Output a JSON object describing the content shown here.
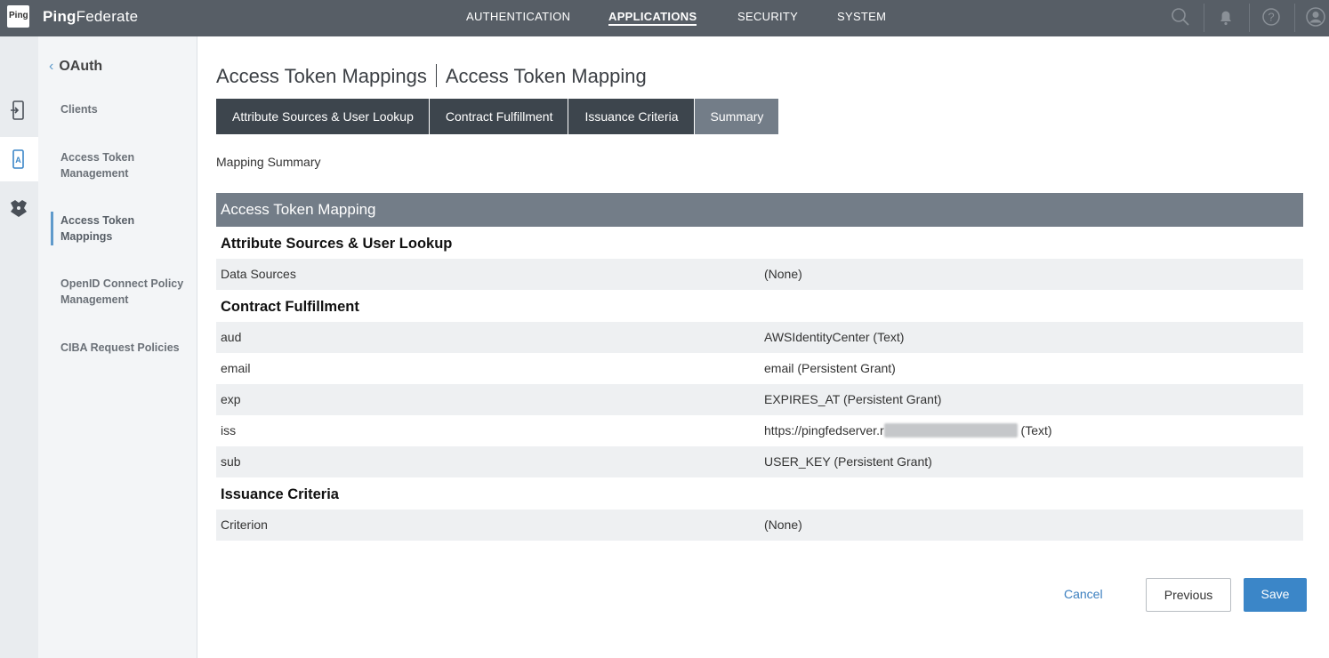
{
  "brand": {
    "logo_text": "Ping",
    "name_bold": "Ping",
    "name_rest": "Federate"
  },
  "topnav": {
    "items": [
      {
        "label": "AUTHENTICATION",
        "active": false
      },
      {
        "label": "APPLICATIONS",
        "active": true
      },
      {
        "label": "SECURITY",
        "active": false
      },
      {
        "label": "SYSTEM",
        "active": false
      }
    ],
    "icons": [
      "search-icon",
      "bell-icon",
      "help-icon",
      "user-icon"
    ]
  },
  "rail": {
    "icons": [
      "device-icon",
      "app-icon",
      "shield-icon"
    ]
  },
  "sidebar": {
    "back_label": "OAuth",
    "items": [
      {
        "label": "Clients",
        "active": false
      },
      {
        "label": "Access Token Management",
        "active": false
      },
      {
        "label": "Access Token Mappings",
        "active": true
      },
      {
        "label": "OpenID Connect Policy Management",
        "active": false
      },
      {
        "label": "CIBA Request Policies",
        "active": false
      }
    ]
  },
  "page": {
    "breadcrumb_parent": "Access Token Mappings",
    "title": "Access Token Mapping",
    "tabs": [
      {
        "label": "Attribute Sources & User Lookup",
        "selected": false
      },
      {
        "label": "Contract Fulfillment",
        "selected": false
      },
      {
        "label": "Issuance Criteria",
        "selected": false
      },
      {
        "label": "Summary",
        "selected": true
      }
    ],
    "subheading": "Mapping Summary"
  },
  "summary": {
    "header": "Access Token Mapping",
    "sections": [
      {
        "title": "Attribute Sources & User Lookup",
        "rows": [
          {
            "name": "Data Sources",
            "value": "(None)"
          }
        ]
      },
      {
        "title": "Contract Fulfillment",
        "rows": [
          {
            "name": "aud",
            "value": "AWSIdentityCenter (Text)"
          },
          {
            "name": "email",
            "value": "email (Persistent Grant)"
          },
          {
            "name": "exp",
            "value": "EXPIRES_AT (Persistent Grant)"
          },
          {
            "name": "iss",
            "value_prefix": "https://pingfedserver.r",
            "value_suffix": " (Text)"
          },
          {
            "name": "sub",
            "value": "USER_KEY (Persistent Grant)"
          }
        ]
      },
      {
        "title": "Issuance Criteria",
        "rows": [
          {
            "name": "Criterion",
            "value": "(None)"
          }
        ]
      }
    ]
  },
  "footer": {
    "cancel_label": "Cancel",
    "previous_label": "Previous",
    "save_label": "Save"
  },
  "colors": {
    "topbar": "#575e66",
    "accent": "#3b86c8",
    "tab_dark": "#3d454d",
    "tab_selected": "#737d88"
  }
}
